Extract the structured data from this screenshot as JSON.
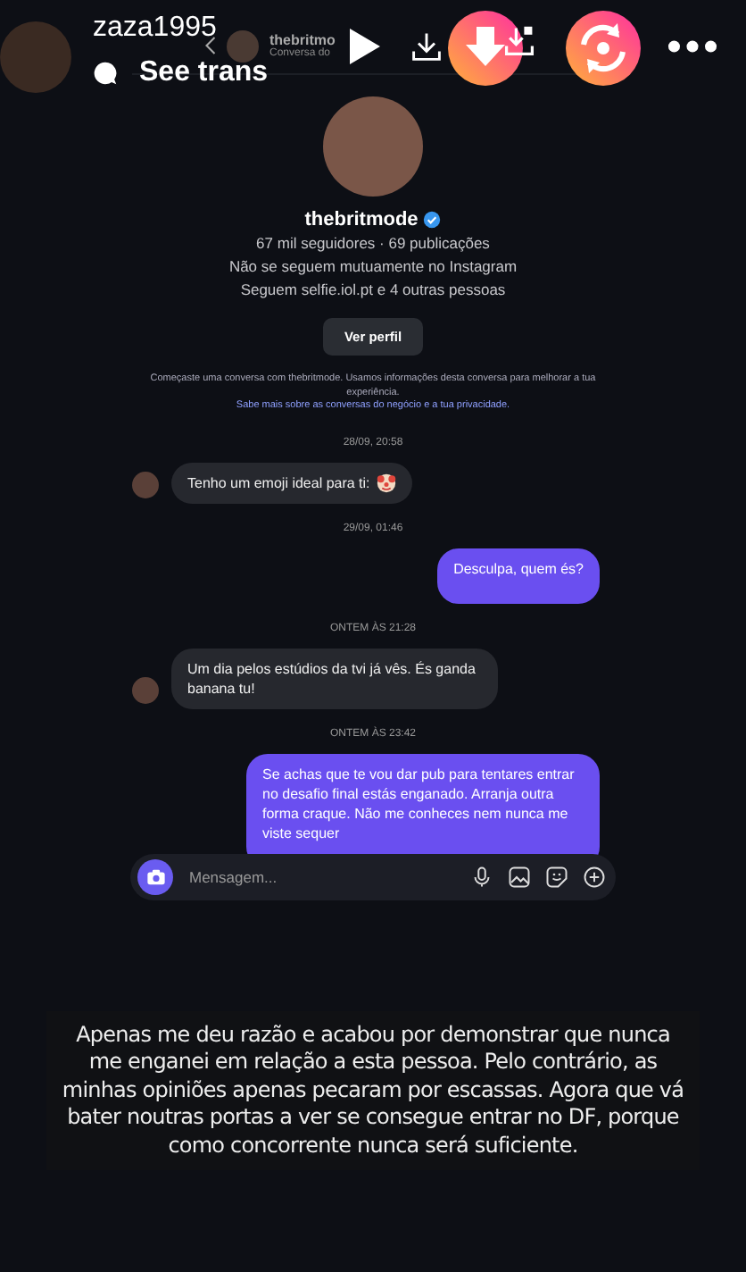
{
  "story": {
    "username": "zaza1995",
    "translate_label": "See trans"
  },
  "chat": {
    "header": {
      "name": "thebritmo",
      "subtitle": "Conversa do"
    },
    "profile": {
      "name": "thebritmode",
      "verified": true,
      "stats": "67 mil seguidores · 69 publicações",
      "lines": [
        "Não se seguem mutuamente no Instagram",
        "Seguem selfie.iol.pt e 4 outras pessoas"
      ],
      "button": "Ver perfil"
    },
    "notice": {
      "text": "Começaste uma conversa com thebritmode. Usamos informações desta conversa para melhorar a tua experiência.",
      "link": "Sabe mais sobre as conversas do negócio e a tua privacidade."
    },
    "items": [
      {
        "kind": "date",
        "text": "28/09, 20:58"
      },
      {
        "kind": "received",
        "text": "Tenho um emoji ideal para ti:",
        "emoji_icon": true
      },
      {
        "kind": "date",
        "text": "29/09, 01:46"
      },
      {
        "kind": "sent",
        "text": "Desculpa, quem és?"
      },
      {
        "kind": "date",
        "text": "ONTEM ÀS 21:28"
      },
      {
        "kind": "received",
        "text": "Um dia pelos estúdios da tvi já vês. És ganda banana tu!",
        "emoji_icon": false
      },
      {
        "kind": "date",
        "text": "ONTEM ÀS 23:42"
      },
      {
        "kind": "sent",
        "text": "Se achas que te vou dar pub para tentares entrar no desafio final estás enganado. Arranja outra forma craque. Não me conheces nem nunca me viste sequer"
      }
    ],
    "composer": {
      "placeholder": "Mensagem..."
    }
  },
  "caption": "Apenas me deu razão e acabou por demonstrar que nunca me enganei em relação a esta pessoa. Pelo contrário, as minhas opiniões apenas pecaram por escassas. Agora que vá bater noutras portas a ver se consegue entrar no DF, porque como concorrente nunca será suficiente."
}
